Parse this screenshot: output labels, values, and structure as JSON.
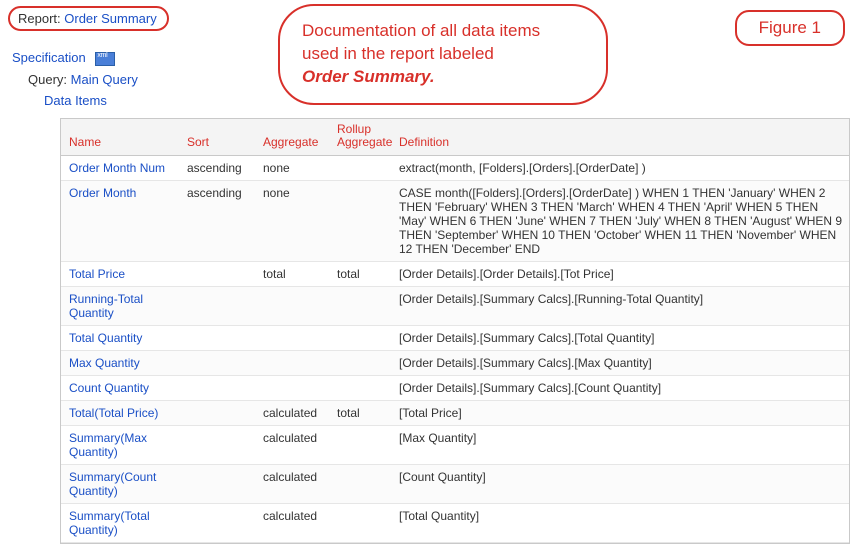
{
  "report": {
    "prefix": "Report:",
    "name": "Order Summary"
  },
  "figure_label": "Figure 1",
  "doc_bubble": {
    "line1": "Documentation of all data items",
    "line2": "used in the report labeled",
    "emph": "Order Summary."
  },
  "tree": {
    "specification": "Specification",
    "query_prefix": "Query:",
    "query_name": "Main Query",
    "data_items": "Data Items"
  },
  "table": {
    "headers": {
      "name": "Name",
      "sort": "Sort",
      "aggregate": "Aggregate",
      "rollup": "Rollup Aggregate",
      "definition": "Definition"
    },
    "rows": [
      {
        "name": "Order Month Num",
        "sort": "ascending",
        "aggregate": "none",
        "rollup": "",
        "definition": "extract(month, [Folders].[Orders].[OrderDate] )"
      },
      {
        "name": "Order Month",
        "sort": "ascending",
        "aggregate": "none",
        "rollup": "",
        "definition": "CASE month([Folders].[Orders].[OrderDate] ) WHEN 1 THEN 'January' WHEN 2 THEN 'February' WHEN 3 THEN 'March' WHEN 4 THEN 'April' WHEN 5 THEN 'May' WHEN 6 THEN 'June' WHEN 7 THEN 'July' WHEN 8 THEN 'August' WHEN 9 THEN 'September' WHEN 10 THEN 'October' WHEN 11 THEN 'November' WHEN 12 THEN 'December' END"
      },
      {
        "name": "Total Price",
        "sort": "",
        "aggregate": "total",
        "rollup": "total",
        "definition": "[Order Details].[Order Details].[Tot Price]"
      },
      {
        "name": "Running-Total Quantity",
        "sort": "",
        "aggregate": "",
        "rollup": "",
        "definition": "[Order Details].[Summary Calcs].[Running-Total Quantity]"
      },
      {
        "name": "Total Quantity",
        "sort": "",
        "aggregate": "",
        "rollup": "",
        "definition": "[Order Details].[Summary Calcs].[Total Quantity]"
      },
      {
        "name": "Max Quantity",
        "sort": "",
        "aggregate": "",
        "rollup": "",
        "definition": "[Order Details].[Summary Calcs].[Max Quantity]"
      },
      {
        "name": "Count Quantity",
        "sort": "",
        "aggregate": "",
        "rollup": "",
        "definition": "[Order Details].[Summary Calcs].[Count Quantity]"
      },
      {
        "name": "Total(Total Price)",
        "sort": "",
        "aggregate": "calculated",
        "rollup": "total",
        "definition": "[Total Price]"
      },
      {
        "name": "Summary(Max Quantity)",
        "sort": "",
        "aggregate": "calculated",
        "rollup": "",
        "definition": "[Max Quantity]"
      },
      {
        "name": "Summary(Count Quantity)",
        "sort": "",
        "aggregate": "calculated",
        "rollup": "",
        "definition": "[Count Quantity]"
      },
      {
        "name": "Summary(Total Quantity)",
        "sort": "",
        "aggregate": "calculated",
        "rollup": "",
        "definition": "[Total Quantity]"
      }
    ]
  }
}
